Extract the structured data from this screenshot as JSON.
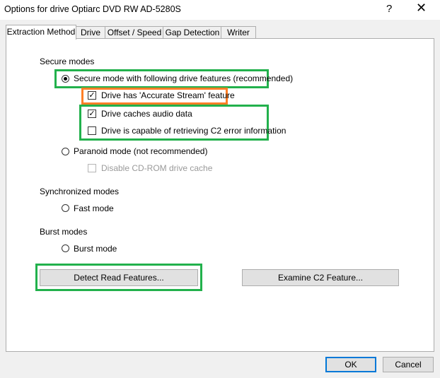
{
  "window": {
    "title": "Options for drive Optiarc DVD RW AD-5280S",
    "help_glyph": "?",
    "close_glyph": "✕"
  },
  "tabs": [
    {
      "label": "Extraction Method",
      "active": true
    },
    {
      "label": "Drive",
      "active": false
    },
    {
      "label": "Offset / Speed",
      "active": false
    },
    {
      "label": "Gap Detection",
      "active": false
    },
    {
      "label": "Writer",
      "active": false
    }
  ],
  "secure": {
    "heading": "Secure modes",
    "secure_mode_label": "Secure mode with following drive features (recommended)",
    "accurate_stream_label": "Drive has 'Accurate Stream' feature",
    "caches_audio_label": "Drive caches audio data",
    "c2_label": "Drive is capable of retrieving C2 error information",
    "paranoid_label": "Paranoid mode (not recommended)",
    "disable_cache_label": "Disable CD-ROM drive cache"
  },
  "sync": {
    "heading": "Synchronized modes",
    "fast_label": "Fast mode"
  },
  "burst": {
    "heading": "Burst modes",
    "burst_label": "Burst mode"
  },
  "buttons": {
    "detect": "Detect Read Features...",
    "examine": "Examine C2 Feature...",
    "ok": "OK",
    "cancel": "Cancel"
  },
  "checkmark": "✓",
  "colors": {
    "highlight_green": "#22b14c",
    "highlight_orange": "#ff7f27",
    "default_button_border": "#0078d7"
  }
}
